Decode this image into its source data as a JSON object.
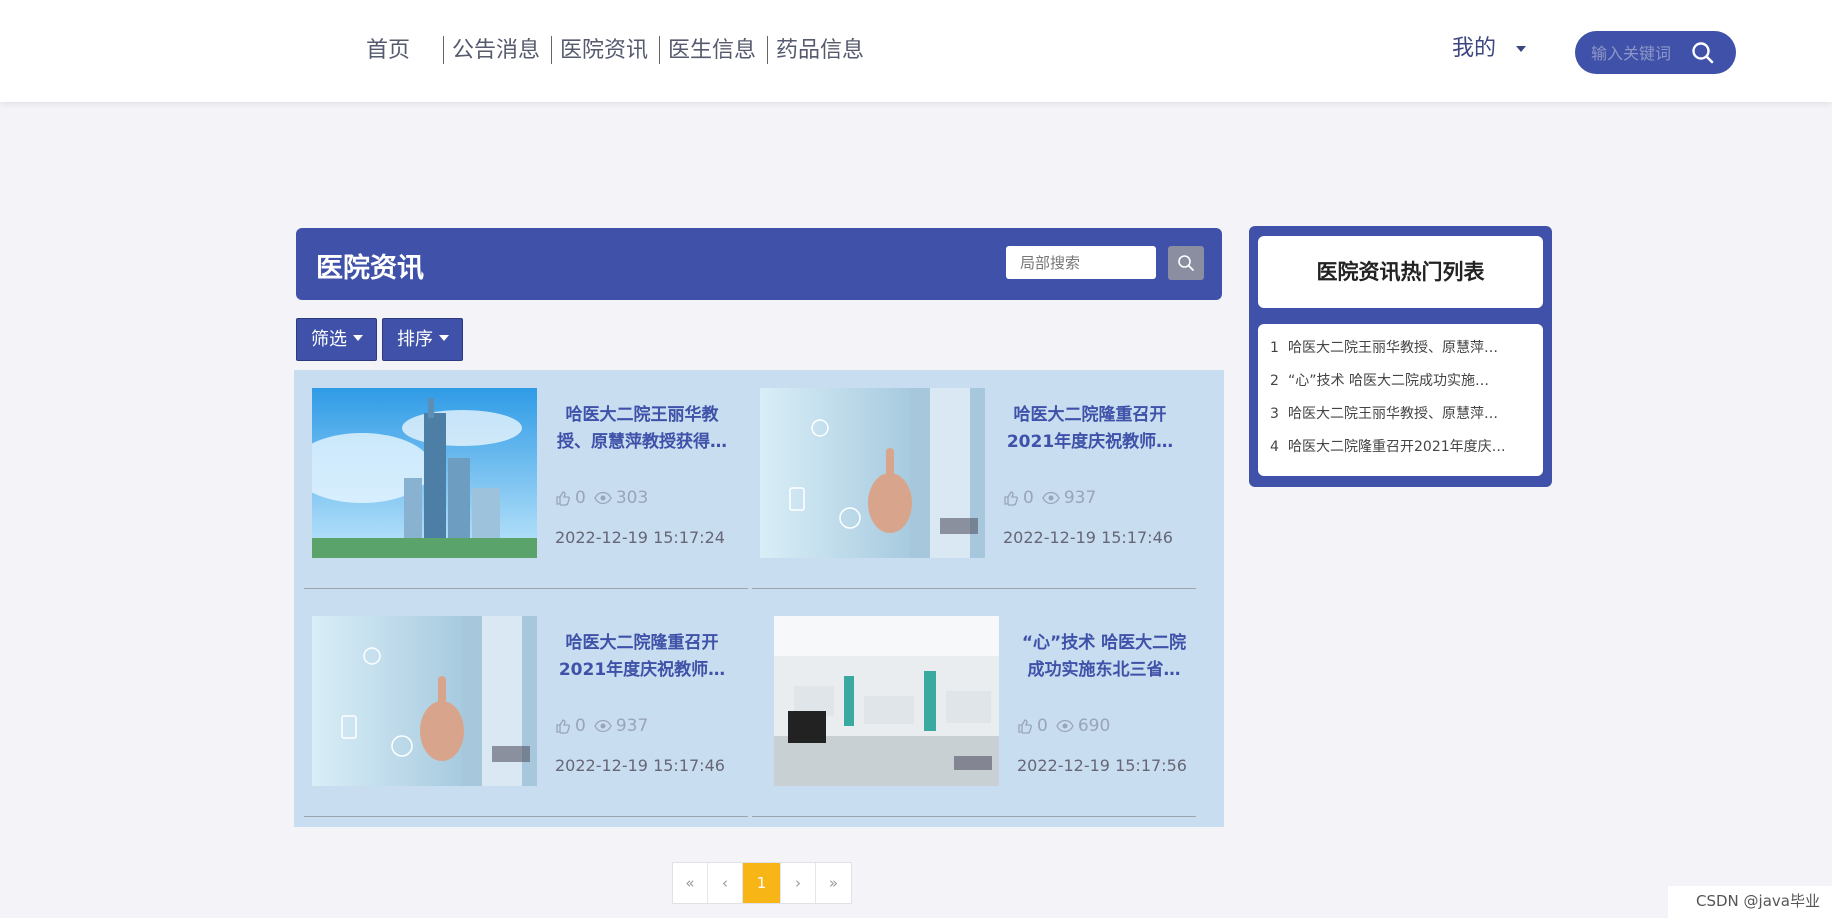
{
  "nav": {
    "items": [
      "首页",
      "公告消息",
      "医院资讯",
      "医生信息",
      "药品信息"
    ],
    "user_menu": "我的",
    "search_placeholder": "输入关键词"
  },
  "main": {
    "title": "医院资讯",
    "local_search_placeholder": "局部搜索",
    "filter_label": "筛选",
    "sort_label": "排序"
  },
  "articles": [
    {
      "title": "哈医大二院王丽华教授、原慧萍教授获得…",
      "likes": "0",
      "views": "303",
      "date": "2022-12-19 15:17:24",
      "image": "skyscraper"
    },
    {
      "title": "哈医大二院隆重召开2021年度庆祝教师…",
      "likes": "0",
      "views": "937",
      "date": "2022-12-19 15:17:46",
      "image": "doctor-touchscreen"
    },
    {
      "title": "哈医大二院隆重召开2021年度庆祝教师…",
      "likes": "0",
      "views": "937",
      "date": "2022-12-19 15:17:46",
      "image": "doctor-touchscreen"
    },
    {
      "title": "“心”技术 哈医大二院成功实施东北三省…",
      "likes": "0",
      "views": "690",
      "date": "2022-12-19 15:17:56",
      "image": "hospital-ward"
    }
  ],
  "pagination": {
    "first": "«",
    "prev": "‹",
    "current": "1",
    "next": "›",
    "last": "»"
  },
  "hot_list": {
    "title": "医院资讯热门列表",
    "items": [
      {
        "num": "1",
        "text": "哈医大二院王丽华教授、原慧萍…"
      },
      {
        "num": "2",
        "text": "“心”技术 哈医大二院成功实施…"
      },
      {
        "num": "3",
        "text": "哈医大二院王丽华教授、原慧萍…"
      },
      {
        "num": "4",
        "text": "哈医大二院隆重召开2021年度庆…"
      }
    ]
  },
  "watermark": "CSDN @java毕业",
  "colors": {
    "primary": "#3f51a8",
    "accent": "#f8b616",
    "grid_background": "#c8def0",
    "page_background": "#f4f4f8"
  }
}
